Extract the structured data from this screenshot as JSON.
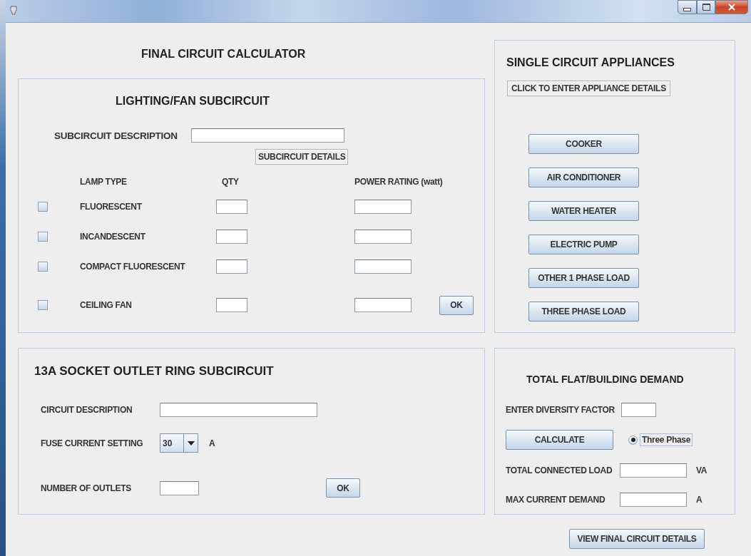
{
  "app_title": "FINAL CIRCUIT CALCULATOR",
  "lighting": {
    "heading": "LIGHTING/FAN SUBCIRCUIT",
    "description_label": "SUBCIRCUIT DESCRIPTION",
    "details_button": "SUBCIRCUIT DETAILS",
    "columns": [
      "LAMP TYPE",
      "QTY",
      "POWER RATING (watt)"
    ],
    "lamps": [
      {
        "label": "FLUORESCENT",
        "checked": false
      },
      {
        "label": "INCANDESCENT",
        "checked": false
      },
      {
        "label": "COMPACT FLUORESCENT",
        "checked": false
      },
      {
        "label": "CEILING FAN",
        "checked": false
      }
    ],
    "ok_button": "OK"
  },
  "appliances": {
    "heading": "SINGLE CIRCUIT APPLIANCES",
    "enter_button": "CLICK TO ENTER APPLIANCE DETAILS",
    "buttons": [
      "COOKER",
      "AIR CONDITIONER",
      "WATER HEATER",
      "ELECTRIC PUMP",
      "OTHER 1 PHASE LOAD",
      "THREE PHASE LOAD"
    ]
  },
  "socket": {
    "heading": "13A SOCKET OUTLET RING SUBCIRCUIT",
    "description_label": "CIRCUIT DESCRIPTION",
    "fuse_label": "FUSE CURRENT SETTING",
    "fuse_value": "30",
    "fuse_unit": "A",
    "outlets_label": "NUMBER OF OUTLETS",
    "ok_button": "OK"
  },
  "demand": {
    "heading": "TOTAL FLAT/BUILDING DEMAND",
    "diversity_label": "ENTER DIVERSITY FACTOR",
    "calculate_button": "CALCULATE",
    "phase_option": {
      "label": "Three Phase",
      "selected": true
    },
    "load_label": "TOTAL CONNECTED LOAD",
    "load_unit": "VA",
    "current_label": "MAX CURRENT DEMAND",
    "current_unit": "A"
  },
  "view_button": "VIEW FINAL CIRCUIT DETAILS"
}
